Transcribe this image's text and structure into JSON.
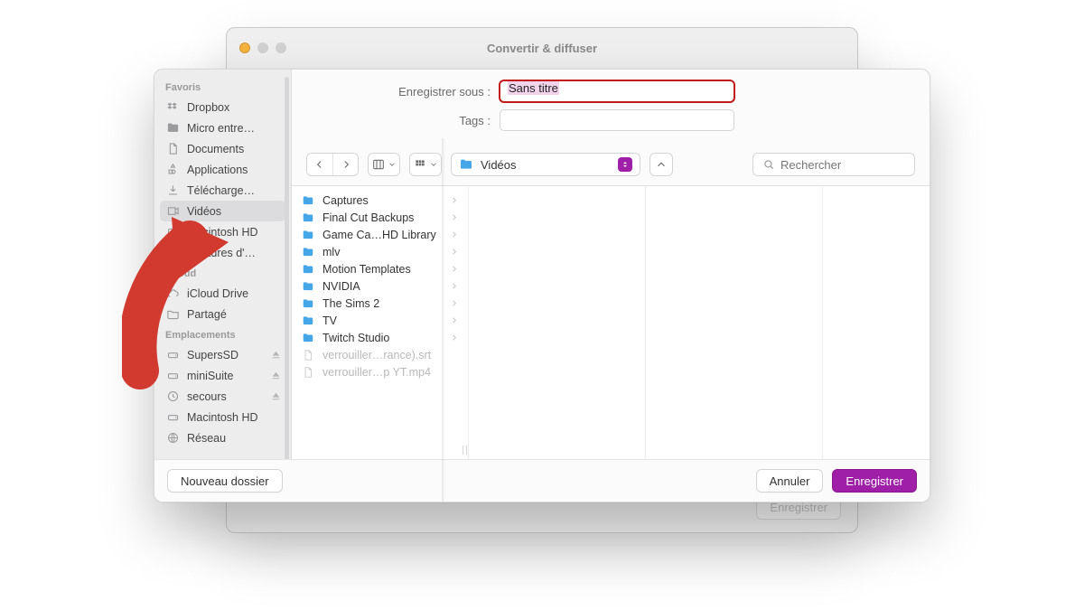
{
  "backwindow": {
    "title": "Convertir & diffuser",
    "ghost_button": "Enregistrer"
  },
  "form": {
    "save_as_label": "Enregistrer sous :",
    "save_as_value": "Sans titre",
    "tags_label": "Tags :"
  },
  "toolbar": {
    "location_label": "Vidéos",
    "search_placeholder": "Rechercher"
  },
  "sidebar": {
    "sections": [
      {
        "title": "Favoris",
        "items": [
          {
            "label": "Dropbox",
            "icon": "dropbox"
          },
          {
            "label": "Micro entre…",
            "icon": "folder"
          },
          {
            "label": "Documents",
            "icon": "doc"
          },
          {
            "label": "Applications",
            "icon": "apps"
          },
          {
            "label": "Télécharge…",
            "icon": "download"
          },
          {
            "label": "Vidéos",
            "icon": "video",
            "selected": true
          },
          {
            "label": "Macintosh HD",
            "icon": "hd"
          },
          {
            "label": "Captures d'…",
            "icon": "camera"
          }
        ]
      },
      {
        "title": "iCloud",
        "items": [
          {
            "label": "iCloud Drive",
            "icon": "cloud"
          },
          {
            "label": "Partagé",
            "icon": "shared"
          }
        ]
      },
      {
        "title": "Emplacements",
        "items": [
          {
            "label": "SupersSD",
            "icon": "drive",
            "eject": true
          },
          {
            "label": "miniSuite",
            "icon": "drive",
            "eject": true
          },
          {
            "label": "secours",
            "icon": "time",
            "eject": true
          },
          {
            "label": "Macintosh HD",
            "icon": "drive"
          },
          {
            "label": "Réseau",
            "icon": "globe"
          }
        ]
      }
    ]
  },
  "listing": [
    {
      "label": "Captures",
      "type": "folder"
    },
    {
      "label": "Final Cut Backups",
      "type": "folder"
    },
    {
      "label": "Game Ca…HD Library",
      "type": "folder"
    },
    {
      "label": "mlv",
      "type": "folder"
    },
    {
      "label": "Motion Templates",
      "type": "folder"
    },
    {
      "label": "NVIDIA",
      "type": "folder"
    },
    {
      "label": "The Sims 2",
      "type": "folder"
    },
    {
      "label": "TV",
      "type": "folder"
    },
    {
      "label": "Twitch Studio",
      "type": "folder"
    },
    {
      "label": "verrouiller…rance).srt",
      "type": "file-dim"
    },
    {
      "label": "verrouiller…p YT.mp4",
      "type": "file-dim"
    }
  ],
  "footer": {
    "new_folder": "Nouveau dossier",
    "cancel": "Annuler",
    "save": "Enregistrer"
  }
}
